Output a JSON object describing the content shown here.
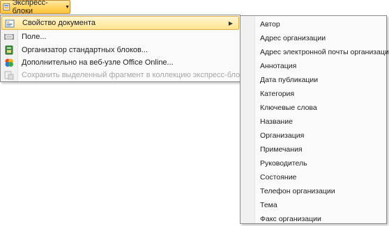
{
  "ribbon": {
    "quickparts_label": "Экспресс-блоки",
    "icon": "quick-parts-icon"
  },
  "menu": {
    "items": [
      {
        "label": "Свойство документа",
        "icon": "document-property-icon"
      },
      {
        "label": "Поле...",
        "icon": "field-icon"
      },
      {
        "label": "Организатор стандартных блоков...",
        "icon": "building-blocks-organizer-icon"
      },
      {
        "label": "Дополнительно на веб-узле Office Online...",
        "icon": "office-online-icon"
      },
      {
        "label": "Сохранить выделенный фрагмент в коллекцию экспресс-блоков...",
        "icon": "save-selection-icon"
      }
    ]
  },
  "submenu": {
    "items": [
      "Автор",
      "Адрес организации",
      "Адрес электронной почты организации",
      "Аннотация",
      "Дата публикации",
      "Категория",
      "Ключевые слова",
      "Название",
      "Организация",
      "Примечания",
      "Руководитель",
      "Состояние",
      "Телефон организации",
      "Тема",
      "Факс организации"
    ]
  },
  "colors": {
    "highlight": "#ffe48e",
    "ribbon_button": "#ffd35e",
    "disabled_text": "#a6a6a6"
  }
}
